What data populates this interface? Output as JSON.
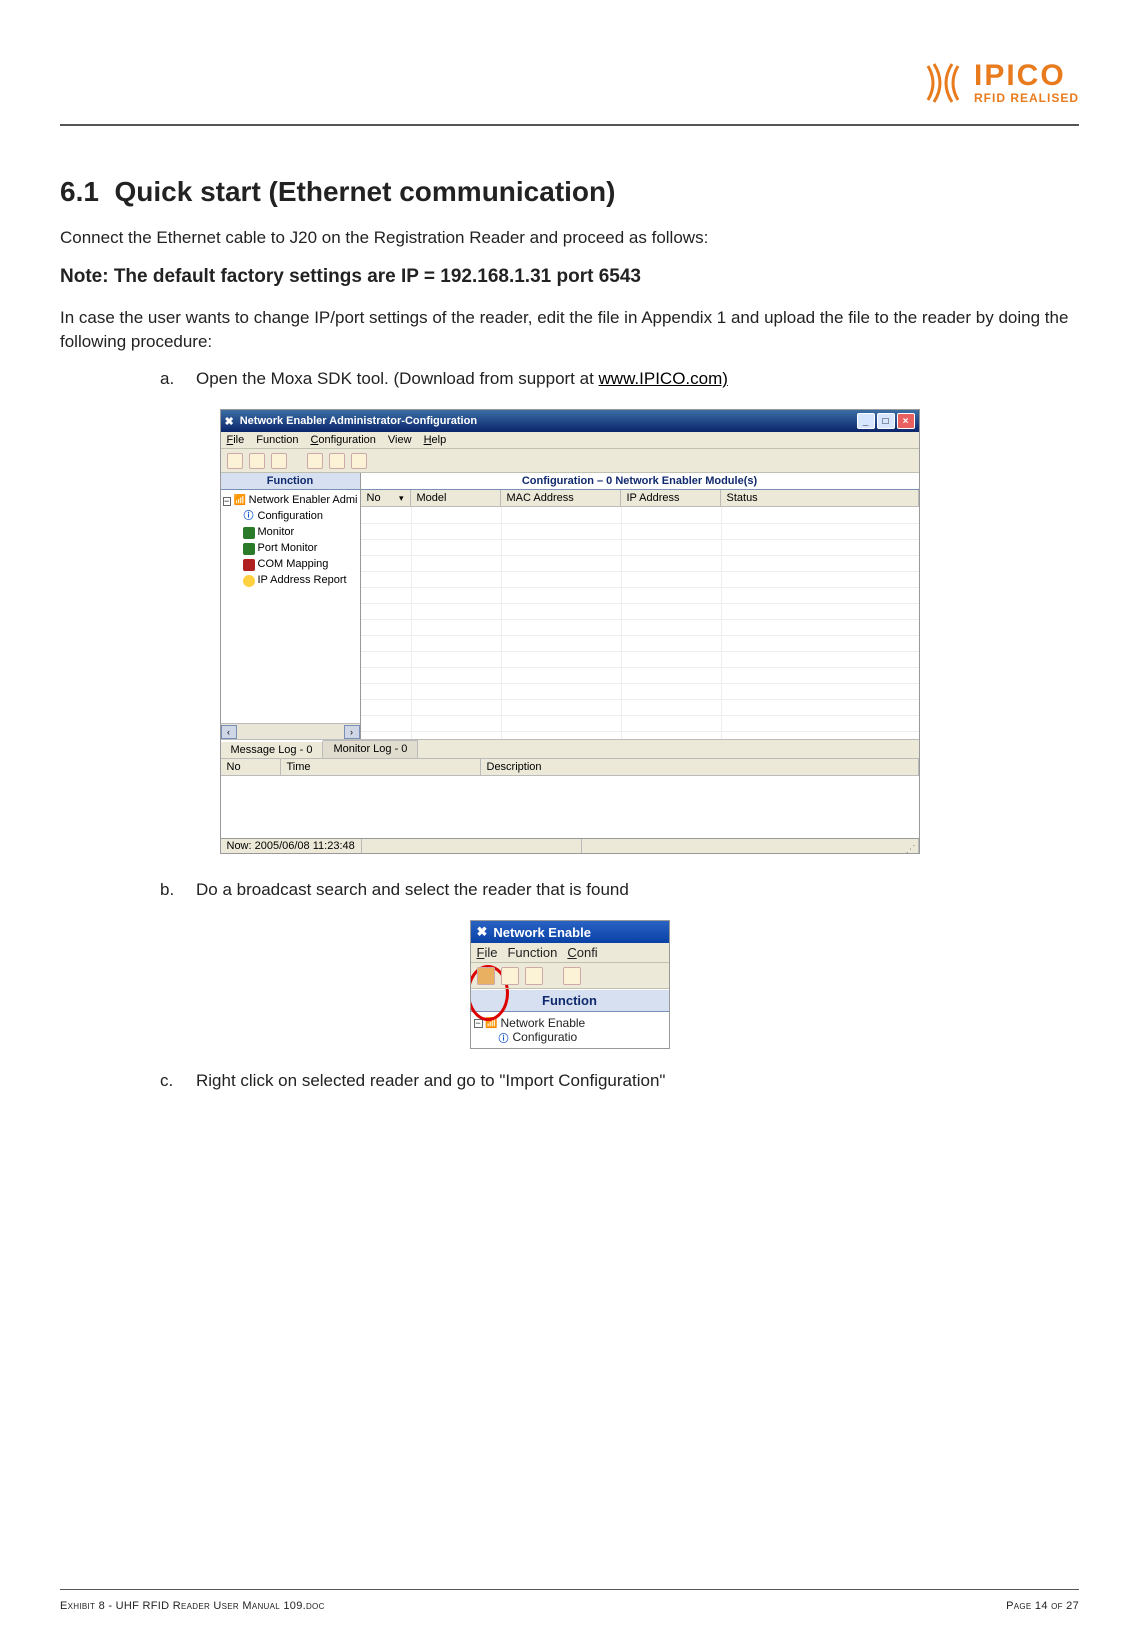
{
  "brand": {
    "name": "IPICO",
    "tagline": "RFID REALISED"
  },
  "section": {
    "number": "6.1",
    "title": "Quick start (Ethernet communication)"
  },
  "paragraphs": {
    "intro": "Connect the Ethernet cable to J20 on the Registration Reader and proceed as follows:",
    "note": "Note: The default factory settings are IP = 192.168.1.31 port 6543",
    "change": "In case the user wants to change IP/port settings of the reader, edit the file in Appendix 1 and upload the file to the reader by doing the following procedure:"
  },
  "steps": {
    "a_marker": "a.",
    "a_text_before_link": "Open the Moxa SDK tool. (Download from support at ",
    "a_link_text": "www.IPICO.com)",
    "b_marker": "b.",
    "b_text": "Do a broadcast search and select the reader that is found",
    "c_marker": "c.",
    "c_text": "Right click on selected reader and go to \"Import Configuration\""
  },
  "ss1": {
    "title": "Network Enabler Administrator-Configuration",
    "menu": {
      "file": "File",
      "function": "Function",
      "configuration": "Configuration",
      "view": "View",
      "help": "Help"
    },
    "left_header": "Function",
    "tree": {
      "root": "Network Enabler Admi",
      "n1": "Configuration",
      "n2": "Monitor",
      "n3": "Port Monitor",
      "n4": "COM Mapping",
      "n5": "IP Address Report"
    },
    "right_header": "Configuration – 0 Network Enabler Module(s)",
    "cols": {
      "no": "No",
      "model": "Model",
      "mac": "MAC Address",
      "ip": "IP Address",
      "status": "Status"
    },
    "tabs": {
      "msg": "Message Log - 0",
      "mon": "Monitor Log - 0"
    },
    "log_cols": {
      "no": "No",
      "time": "Time",
      "desc": "Description"
    },
    "status": "Now: 2005/06/08 11:23:48"
  },
  "ss2": {
    "title": "Network Enable",
    "menu": {
      "file": "File",
      "function": "Function",
      "confi": "Confi"
    },
    "func": "Function",
    "tree": {
      "root": "Network Enable",
      "child": "Configuratio"
    }
  },
  "footer": {
    "left": "Exhibit 8 - UHF RFID Reader User Manual 109.doc",
    "right": "Page 14 of 27"
  }
}
